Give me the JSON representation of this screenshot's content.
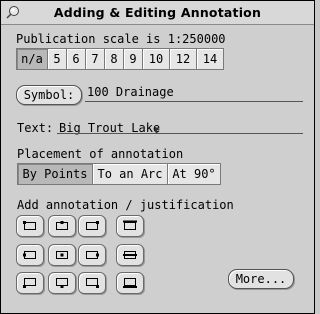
{
  "window": {
    "title": "Adding & Editing Annotation"
  },
  "scale": {
    "label": "Publication scale is 1:250000",
    "options": [
      "n/a",
      "5",
      "6",
      "7",
      "8",
      "9",
      "10",
      "12",
      "14"
    ],
    "selected": "n/a"
  },
  "symbol": {
    "button_label": "Symbol:",
    "value": "100 Drainage"
  },
  "text_field": {
    "label": "Text:",
    "value": "Big Trout Lake"
  },
  "placement": {
    "label": "Placement of annotation",
    "options": [
      "By Points",
      "To an Arc",
      "At 90°"
    ],
    "selected": "By Points"
  },
  "justification": {
    "label": "Add annotation / justification"
  },
  "more_button": "More..."
}
